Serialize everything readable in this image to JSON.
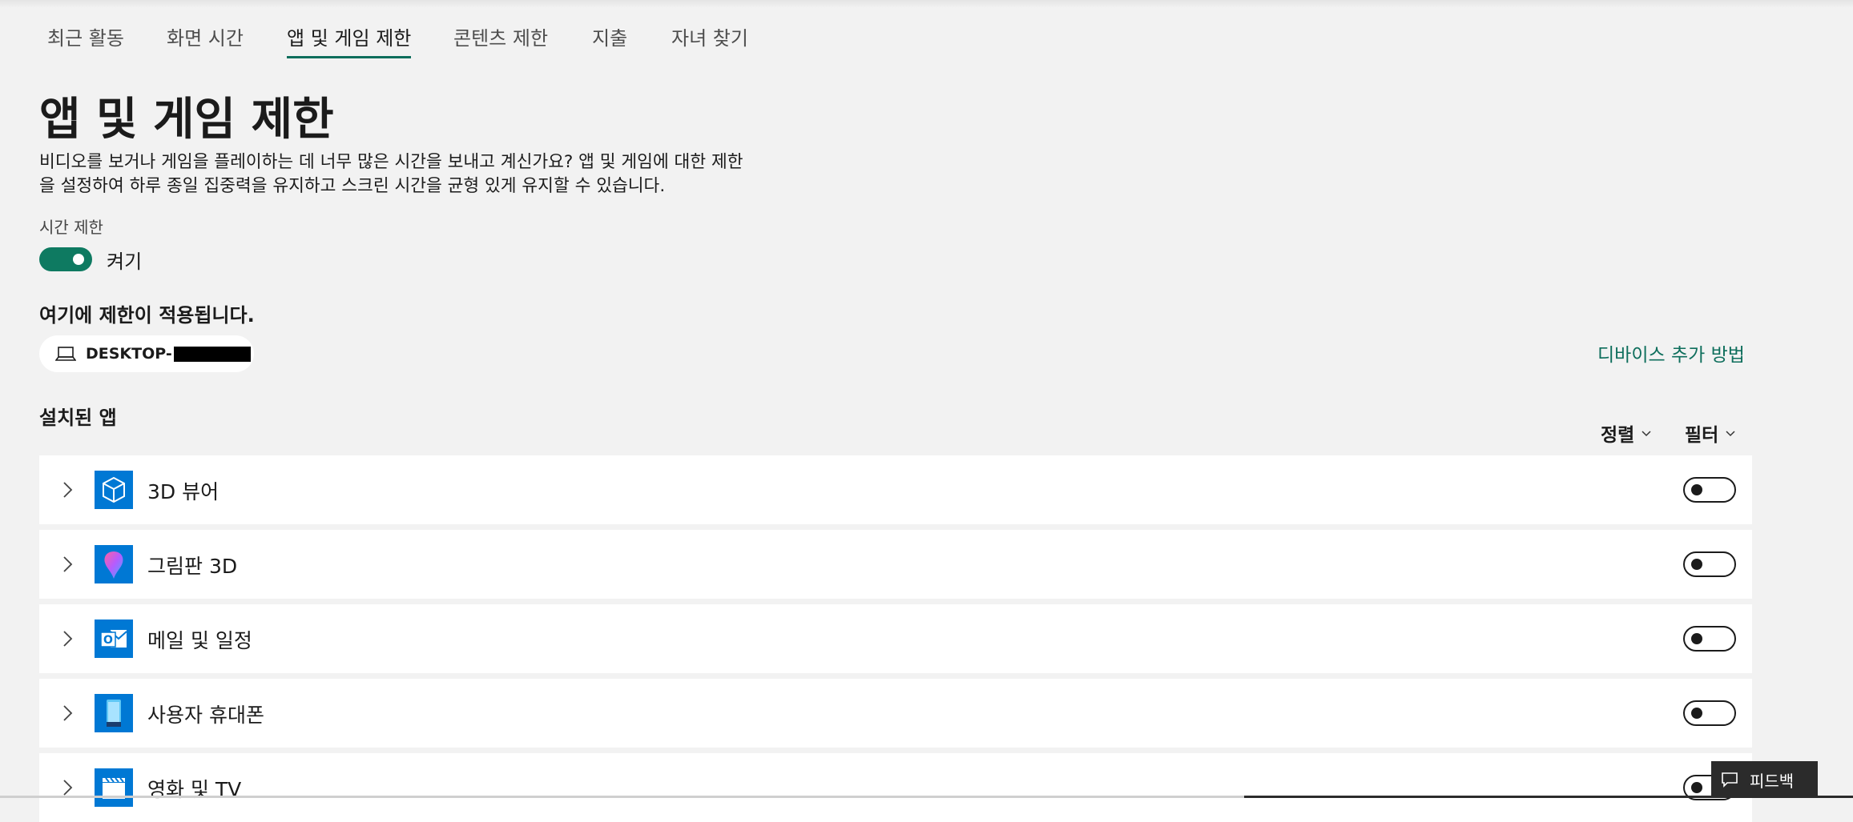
{
  "tabs": [
    {
      "label": "최근 활동"
    },
    {
      "label": "화면 시간"
    },
    {
      "label": "앱 및 게임 제한"
    },
    {
      "label": "콘텐츠 제한"
    },
    {
      "label": "지출"
    },
    {
      "label": "자녀 찾기"
    }
  ],
  "active_tab": "앱 및 게임 제한",
  "page": {
    "title": "앱 및 게임 제한",
    "description_line1": "비디오를 보거나 게임을 플레이하는 데 너무 많은 시간을 보내고 계신가요? 앱 및 게임에 대한 제한",
    "description_line2": "을 설정하여 하루 종일 집중력을 유지하고 스크린 시간을 균형 있게 유지할 수 있습니다."
  },
  "time_limit": {
    "label": "시간 제한",
    "state_label": "켜기",
    "on": true
  },
  "applies": {
    "heading": "여기에 제한이 적용됩니다.",
    "device_name": "DESKTOP-",
    "add_device_link": "디바이스 추가 방법"
  },
  "installed": {
    "heading": "설치된 앱",
    "sort_label": "정렬",
    "filter_label": "필터"
  },
  "apps": [
    {
      "name": "3D 뷰어",
      "icon": "3d-viewer-icon",
      "enabled": false
    },
    {
      "name": "그림판 3D",
      "icon": "paint-3d-icon",
      "enabled": false
    },
    {
      "name": "메일 및 일정",
      "icon": "mail-calendar-icon",
      "enabled": false
    },
    {
      "name": "사용자 휴대폰",
      "icon": "your-phone-icon",
      "enabled": false
    },
    {
      "name": "영화 및 TV",
      "icon": "movies-tv-icon",
      "enabled": false
    }
  ],
  "feedback": {
    "label": "피드백",
    "icon": "comment-icon"
  },
  "colors": {
    "accent": "#0e6e5c",
    "background": "#f2f2f2",
    "app_tile": "#0078d4"
  }
}
